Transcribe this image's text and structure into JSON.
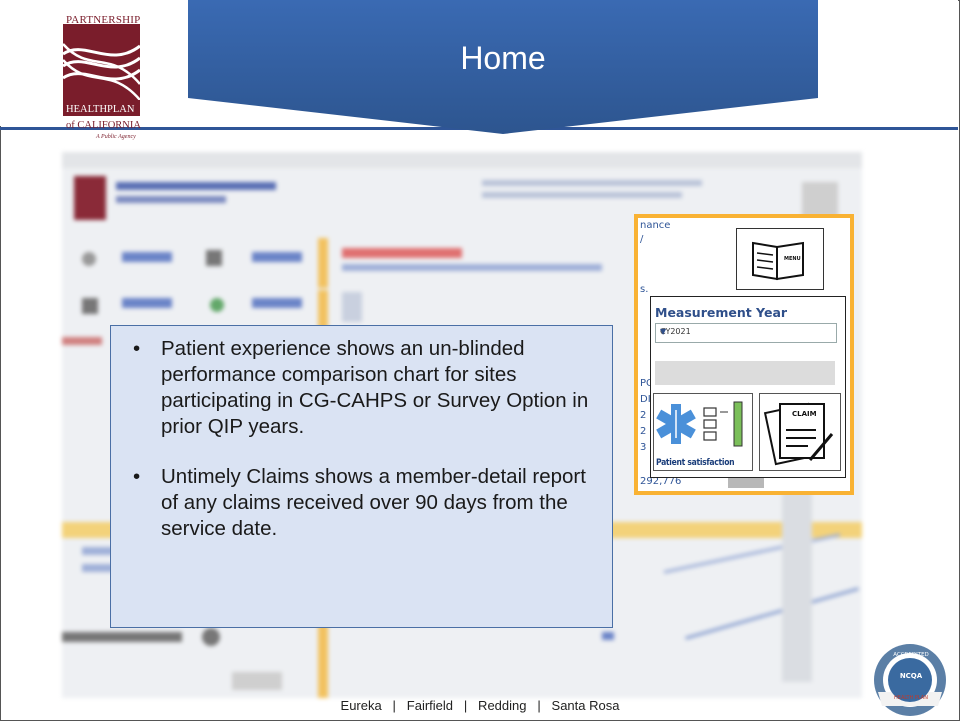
{
  "slide": {
    "title": "Home",
    "footer": "Eureka   |   Fairfield   |   Redding   |   Santa Rosa"
  },
  "logo": {
    "line1": "PARTNERSHIP",
    "line2": "HEALTHPLAN",
    "line3": "of CALIFORNIA",
    "line4": "A Public Agency"
  },
  "textbox": {
    "bullets": [
      "Patient experience shows an un-blinded performance comparison chart for sites participating in CG-CAHPS or Survey Option in prior QIP years.",
      "Untimely Claims shows a member-detail report of any claims received over 90 days from the service date."
    ]
  },
  "highlight": {
    "partial_texts": [
      "nance",
      "/",
      "s.",
      "PO",
      "DI",
      "2",
      "2",
      "3",
      "292,776"
    ],
    "menu_label": "MENU",
    "measurement_title": "Measurement Year",
    "measurement_value": "CY2021",
    "patient_label": "Patient satisfaction",
    "claim_label": "CLAIM"
  },
  "badge": {
    "top": "ACCREDITED",
    "middle": "NCQA",
    "bottom": "HEALTH PLAN"
  },
  "colors": {
    "banner": "#2f5597",
    "highlight_border": "#f9b233",
    "textbox_bg": "#dae3f3",
    "logo": "#7a1d2b"
  }
}
